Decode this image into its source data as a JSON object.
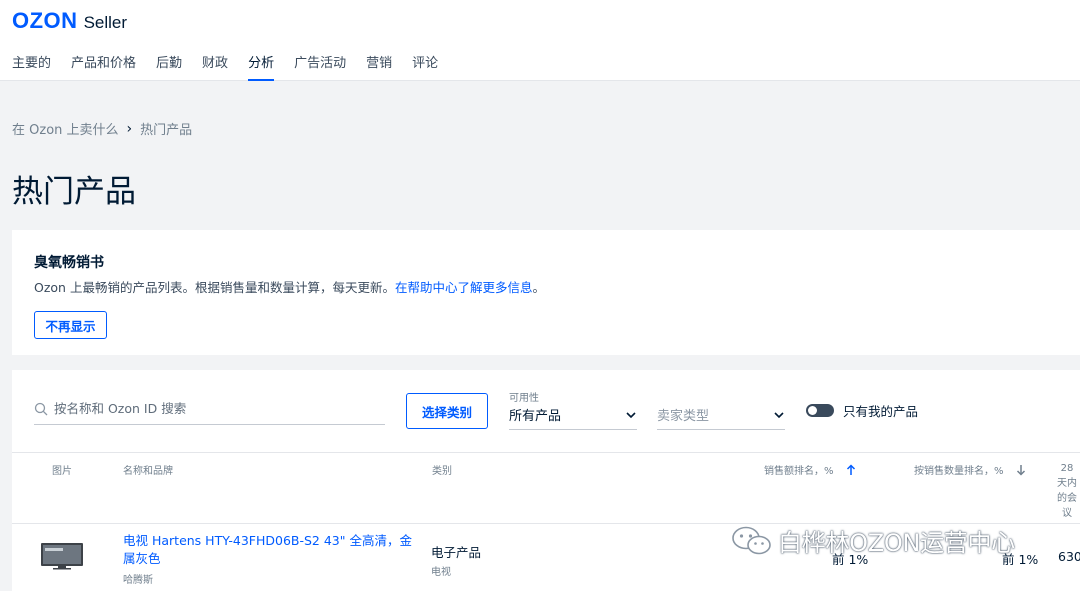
{
  "app": {
    "logo_brand": "OZON",
    "logo_product": "Seller"
  },
  "nav": [
    "主要的",
    "产品和价格",
    "后勤",
    "财政",
    "分析",
    "广告活动",
    "营销",
    "评论"
  ],
  "breadcrumb": {
    "parent": "在 Ozon 上卖什么",
    "separator_icon": "chevron-right-icon",
    "current": "热门产品"
  },
  "page_title": "热门产品",
  "info_card": {
    "title": "臭氧畅销书",
    "text": "Ozon 上最畅销的产品列表。根据销售量和数量计算，每天更新。",
    "link": "在帮助中心了解更多信息",
    "text_end": "。",
    "dismiss_label": "不再显示"
  },
  "filters": {
    "search_placeholder": "按名称和 Ozon ID 搜索",
    "category_button": "选择类别",
    "availability_label": "可用性",
    "availability_value": "所有产品",
    "seller_type_placeholder": "卖家类型",
    "only_mine_label": "只有我的产品",
    "only_mine_on": false
  },
  "table": {
    "headers": {
      "image": "图片",
      "name": "名称和品牌",
      "category": "类别",
      "revenue_rank": "销售额排名，%",
      "quantity_rank": "按销售数量排名，%",
      "days28": [
        "28",
        "天内",
        "的会",
        "议"
      ]
    },
    "rows": [
      {
        "name": "电视 Hartens HTY-43FHD06B-S2 43\" 全高清，金属灰色",
        "brand": "哈腾斯",
        "category": "电子产品",
        "subcategory": "电视",
        "revenue_rank": "前 1%",
        "quantity_rank": "前 1%",
        "days28": "630"
      }
    ]
  },
  "watermark": "白桦林OZON运营中心",
  "colors": {
    "accent": "#005bff",
    "text": "#001a34",
    "muted": "#707f8d",
    "background": "#f2f3f5"
  }
}
